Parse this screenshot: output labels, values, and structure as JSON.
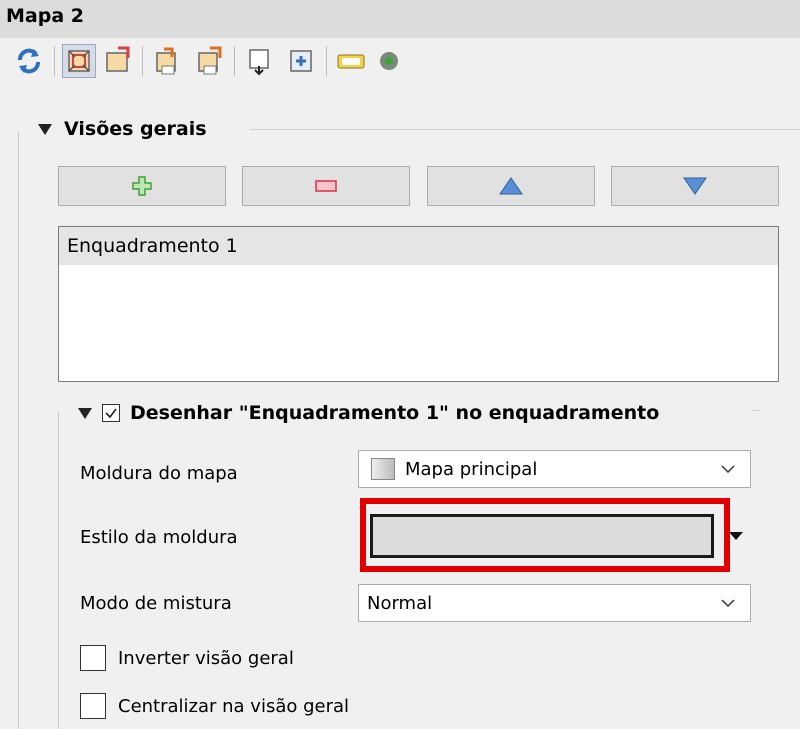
{
  "window": {
    "title": "Mapa 2"
  },
  "toolbar": {
    "icons": [
      "refresh-icon",
      "zoom-to-extent-icon",
      "set-extent-icon",
      "view-extent-icon",
      "set-view-extent-icon",
      "move-content-icon",
      "atlas-icon",
      "label-icon",
      "settings-icon"
    ]
  },
  "overviews": {
    "section_title": "Visões gerais",
    "items": [
      "Enquadramento 1"
    ]
  },
  "overview_settings": {
    "group_title": "Desenhar \"Enquadramento 1\" no enquadramento",
    "map_frame_label": "Moldura do mapa",
    "map_frame_value": "Mapa principal",
    "frame_style_label": "Estilo da moldura",
    "blend_mode_label": "Modo de mistura",
    "blend_mode_value": "Normal",
    "invert_label": "Inverter visão geral",
    "center_label": "Centralizar na visão geral"
  },
  "colors": {
    "highlight": "#e00000",
    "add_green": "#3aa33a",
    "remove_red": "#d9304a",
    "arrow_blue": "#3a78c9"
  }
}
